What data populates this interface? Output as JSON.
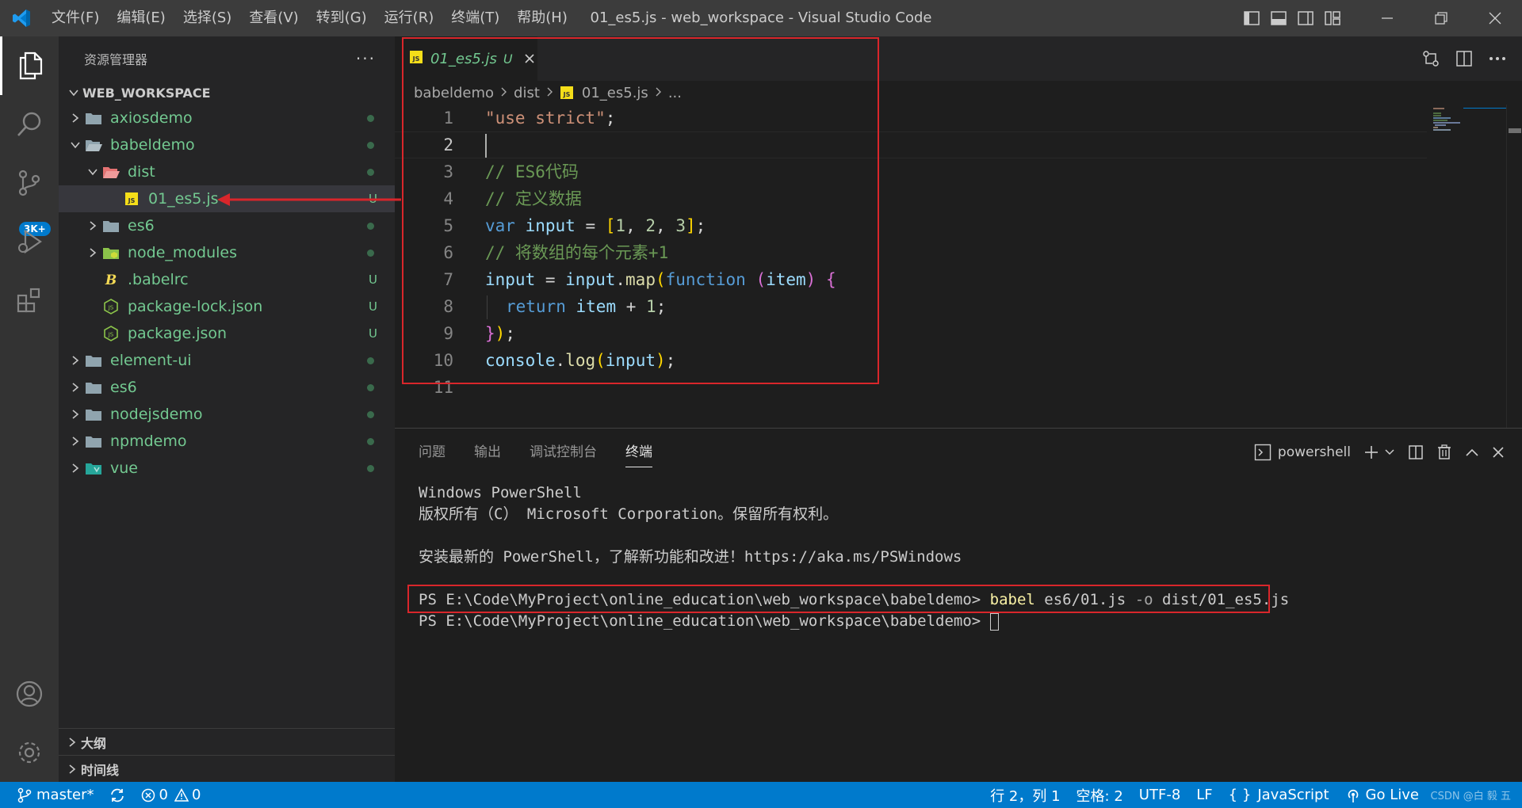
{
  "window": {
    "title": "01_es5.js - web_workspace - Visual Studio Code"
  },
  "menu": [
    "文件(F)",
    "编辑(E)",
    "选择(S)",
    "查看(V)",
    "转到(G)",
    "运行(R)",
    "终端(T)",
    "帮助(H)"
  ],
  "activity": {
    "scm_badge": "3K+"
  },
  "sidebar": {
    "title": "资源管理器",
    "more": "···",
    "workspace": "WEB_WORKSPACE",
    "tree": [
      {
        "label": "axiosdemo",
        "status": ""
      },
      {
        "label": "babeldemo",
        "status": ""
      },
      {
        "label": "dist",
        "status": ""
      },
      {
        "label": "01_es5.js",
        "status": "U"
      },
      {
        "label": "es6",
        "status": ""
      },
      {
        "label": "node_modules",
        "status": ""
      },
      {
        "label": ".babelrc",
        "status": "U"
      },
      {
        "label": "package-lock.json",
        "status": "U"
      },
      {
        "label": "package.json",
        "status": "U"
      },
      {
        "label": "element-ui",
        "status": ""
      },
      {
        "label": "es6",
        "status": ""
      },
      {
        "label": "nodejsdemo",
        "status": ""
      },
      {
        "label": "npmdemo",
        "status": ""
      },
      {
        "label": "vue",
        "status": ""
      }
    ],
    "outline": "大纲",
    "timeline": "时间线"
  },
  "editor": {
    "tab_label": "01_es5.js",
    "tab_status": "U",
    "breadcrumb": [
      "babeldemo",
      "dist",
      "01_es5.js",
      "..."
    ],
    "line_numbers": [
      "1",
      "2",
      "3",
      "4",
      "5",
      "6",
      "7",
      "8",
      "9",
      "10",
      "11"
    ],
    "code": {
      "l1_str": "\"use strict\"",
      "l1_end": ";",
      "l3": "// ES6代码",
      "l4": "// 定义数据",
      "l5_kw": "var",
      "l5_var": "input",
      "l5_eq": " = ",
      "l5_open": "[",
      "l5_n1": "1",
      "l5_c1": ", ",
      "l5_n2": "2",
      "l5_c2": ", ",
      "l5_n3": "3",
      "l5_close": "]",
      "l5_end": ";",
      "l6": "// 将数组的每个元素+1",
      "l7_var": "input",
      "l7_eq": " = ",
      "l7_obj": "input",
      "l7_dot": ".",
      "l7_fn": "map",
      "l7_p1": "(",
      "l7_kw": "function",
      "l7_sp": " ",
      "l7_p2": "(",
      "l7_arg": "item",
      "l7_p3": ")",
      "l7_sp2": " ",
      "l7_brace": "{",
      "l8_kw": "return",
      "l8_var": "item",
      "l8_op": " + ",
      "l8_num": "1",
      "l8_end": ";",
      "l9_brace": "}",
      "l9_paren": ")",
      "l9_end": ";",
      "l10_obj": "console",
      "l10_dot": ".",
      "l10_fn": "log",
      "l10_p1": "(",
      "l10_var": "input",
      "l10_p2": ")",
      "l10_end": ";"
    }
  },
  "panel": {
    "tabs": [
      "问题",
      "输出",
      "调试控制台",
      "终端"
    ],
    "shell": "powershell",
    "terminal": {
      "l1": "Windows PowerShell",
      "l2": "版权所有（C） Microsoft Corporation。保留所有权利。",
      "l3": "",
      "l4": "安装最新的 PowerShell，了解新功能和改进！https://aka.ms/PSWindows",
      "l5": "",
      "prompt": "PS E:\\Code\\MyProject\\online_education\\web_workspace\\babeldemo> ",
      "cmd_babel": "babel",
      "cmd_arg1": " es6/01.js ",
      "cmd_flag": "-o",
      "cmd_arg2": " dist/01_es5.js",
      "prompt2": "PS E:\\Code\\MyProject\\online_education\\web_workspace\\babeldemo> "
    }
  },
  "statusbar": {
    "branch": "master*",
    "errors": "0",
    "warnings": "0",
    "position": "行 2，列 1",
    "spaces": "空格: 2",
    "encoding": "UTF-8",
    "eol": "LF",
    "language": "JavaScript",
    "golive": "Go Live",
    "watermark": "CSDN @白 毅 五"
  },
  "colors": {
    "accent": "#007acc",
    "untracked": "#73c991",
    "annotation": "#d9262b"
  }
}
